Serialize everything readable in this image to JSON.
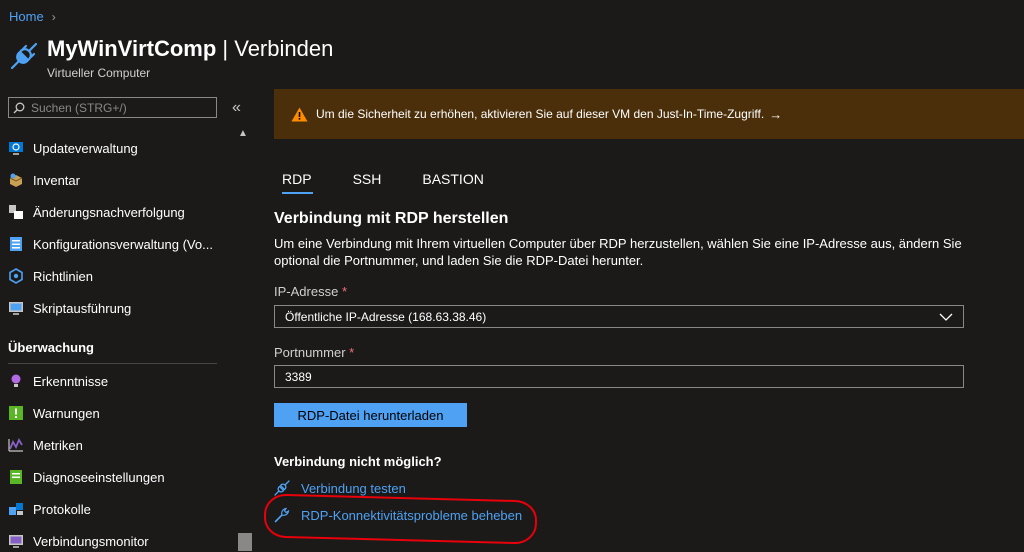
{
  "breadcrumb": {
    "home": "Home",
    "chevron": "›"
  },
  "header": {
    "title_bold": "MyWinVirtComp",
    "title_rest": " | Verbinden",
    "subtitle": "Virtueller Computer"
  },
  "sidebar": {
    "search_placeholder": "Suchen (STRG+/)",
    "collapse": "«",
    "scroll_up": "▲",
    "items_top": [
      {
        "label": "Updateverwaltung",
        "icon": "update-management-icon"
      },
      {
        "label": "Inventar",
        "icon": "inventory-icon"
      },
      {
        "label": "Änderungsnachverfolgung",
        "icon": "change-tracking-icon"
      },
      {
        "label": "Konfigurationsverwaltung (Vo...",
        "icon": "configuration-management-icon"
      },
      {
        "label": "Richtlinien",
        "icon": "policies-icon"
      },
      {
        "label": "Skriptausführung",
        "icon": "run-command-icon"
      }
    ],
    "section": "Überwachung",
    "items_monitoring": [
      {
        "label": "Erkenntnisse",
        "icon": "insights-icon"
      },
      {
        "label": "Warnungen",
        "icon": "alerts-icon"
      },
      {
        "label": "Metriken",
        "icon": "metrics-icon"
      },
      {
        "label": "Diagnoseeinstellungen",
        "icon": "diagnostic-settings-icon"
      },
      {
        "label": "Protokolle",
        "icon": "logs-icon"
      },
      {
        "label": "Verbindungsmonitor",
        "icon": "connection-monitor-icon"
      }
    ]
  },
  "banner": {
    "text": "Um die Sicherheit zu erhöhen, aktivieren Sie auf dieser VM den Just-In-Time-Zugriff.",
    "arrow": "→"
  },
  "tabs": [
    "RDP",
    "SSH",
    "BASTION"
  ],
  "active_tab": "RDP",
  "rdp": {
    "heading": "Verbindung mit RDP herstellen",
    "description": "Um eine Verbindung mit Ihrem virtuellen Computer über RDP herzustellen, wählen Sie eine IP-Adresse aus, ändern Sie optional die Portnummer, und laden Sie die RDP-Datei herunter.",
    "ip_label": "IP-Adresse",
    "ip_value": "Öffentliche IP-Adresse (168.63.38.46)",
    "port_label": "Portnummer",
    "port_value": "3389",
    "required_marker": "*",
    "download_button": "RDP-Datei herunterladen"
  },
  "troubleshoot": {
    "heading": "Verbindung nicht möglich?",
    "test_link": "Verbindung testen",
    "fix_link": "RDP-Konnektivitätsprobleme beheben"
  },
  "colors": {
    "background": "#1b1a19",
    "accent": "#4ea1f3",
    "warning_banner": "#4a2f0a",
    "highlight_circle": "#e8000b"
  }
}
